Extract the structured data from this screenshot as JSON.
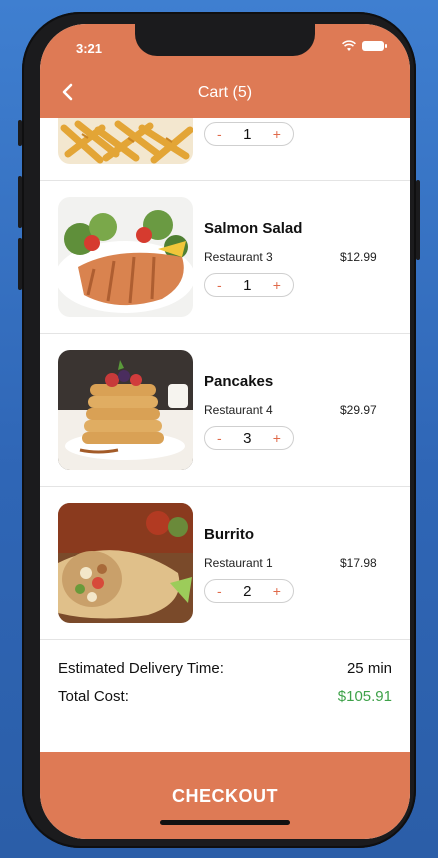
{
  "status": {
    "time": "3:21"
  },
  "header": {
    "title": "Cart (5)"
  },
  "items": [
    {
      "name": "",
      "restaurant": "",
      "price": "",
      "qty": "1"
    },
    {
      "name": "Salmon Salad",
      "restaurant": "Restaurant 3",
      "price": "$12.99",
      "qty": "1"
    },
    {
      "name": "Pancakes",
      "restaurant": "Restaurant 4",
      "price": "$29.97",
      "qty": "3"
    },
    {
      "name": "Burrito",
      "restaurant": "Restaurant 1",
      "price": "$17.98",
      "qty": "2"
    }
  ],
  "qty_controls": {
    "minus": "-",
    "plus": "+"
  },
  "summary": {
    "delivery_label": "Estimated Delivery Time:",
    "delivery_value": "25 min",
    "total_label": "Total Cost:",
    "total_value": "$105.91"
  },
  "checkout": {
    "label": "CHECKOUT"
  },
  "colors": {
    "accent": "#de7a55",
    "total": "#3fa24a",
    "background": "#3f7fd0"
  },
  "icons": [
    "chevron-left-icon",
    "wifi-icon",
    "battery-icon"
  ]
}
